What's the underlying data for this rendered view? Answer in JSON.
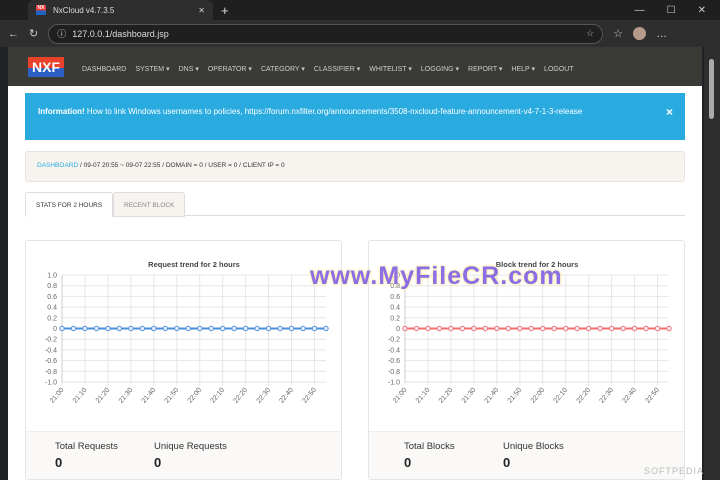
{
  "browser": {
    "tab_title": "NxCloud v4.7.3.5",
    "url": "127.0.0.1/dashboard.jsp",
    "favicon_text": "NX"
  },
  "nav": {
    "logo": "NXF",
    "items": [
      "DASHBOARD",
      "SYSTEM ▾",
      "DNS ▾",
      "OPERATOR ▾",
      "CATEGORY ▾",
      "CLASSIFIER ▾",
      "WHITELIST ▾",
      "LOGGING ▾",
      "REPORT ▾",
      "HELP ▾",
      "LOGOUT"
    ]
  },
  "info": {
    "strong": "Information!",
    "text": " How to link Windows usernames to policies, https://forum.nxfilter.org/announcements/3508-nxcloud-feature-announcement-v4-7-1-3-release",
    "close": "×"
  },
  "breadcrumb": {
    "link": "DASHBOARD",
    "parts": [
      " / 09-07 20:55 ~ 09-07 22:55 / DOMAIN = 0 / USER = 0 / CLIENT IP = 0"
    ]
  },
  "tabs": [
    "STATS FOR 2 HOURS",
    "RECENT BLOCK"
  ],
  "chart_data": [
    {
      "type": "line",
      "title": "Request trend for 2 hours",
      "color": "#4a90d9",
      "ylim": [
        -1,
        1
      ],
      "yticks": [
        "1.0",
        "0.8",
        "0.6",
        "0.4",
        "0.2",
        "0",
        "-0.2",
        "-0.4",
        "-0.6",
        "-0.8",
        "-1.0"
      ],
      "xticks": [
        "21:00",
        "21:10",
        "21:20",
        "21:30",
        "21:40",
        "21:50",
        "22:00",
        "22:10",
        "22:20",
        "22:30",
        "22:40",
        "22:50"
      ],
      "values": [
        0,
        0,
        0,
        0,
        0,
        0,
        0,
        0,
        0,
        0,
        0,
        0,
        0,
        0,
        0,
        0,
        0,
        0,
        0,
        0,
        0,
        0,
        0,
        0
      ]
    },
    {
      "type": "line",
      "title": "Block trend for 2 hours",
      "color": "#f26d6d",
      "ylim": [
        -1,
        1
      ],
      "yticks": [
        "1.0",
        "0.8",
        "0.6",
        "0.4",
        "0.2",
        "0",
        "-0.2",
        "-0.4",
        "-0.6",
        "-0.8",
        "-1.0"
      ],
      "xticks": [
        "21:00",
        "21:10",
        "21:20",
        "21:30",
        "21:40",
        "21:50",
        "22:00",
        "22:10",
        "22:20",
        "22:30",
        "22:40",
        "22:50"
      ],
      "values": [
        0,
        0,
        0,
        0,
        0,
        0,
        0,
        0,
        0,
        0,
        0,
        0,
        0,
        0,
        0,
        0,
        0,
        0,
        0,
        0,
        0,
        0,
        0,
        0
      ]
    }
  ],
  "stats": [
    [
      {
        "label": "Total Requests",
        "value": "0"
      },
      {
        "label": "Unique Requests",
        "value": "0"
      }
    ],
    [
      {
        "label": "Total Blocks",
        "value": "0"
      },
      {
        "label": "Unique Blocks",
        "value": "0"
      }
    ]
  ],
  "watermarks": [
    "www.MyFileCR.com",
    "SOFTPEDIA"
  ]
}
